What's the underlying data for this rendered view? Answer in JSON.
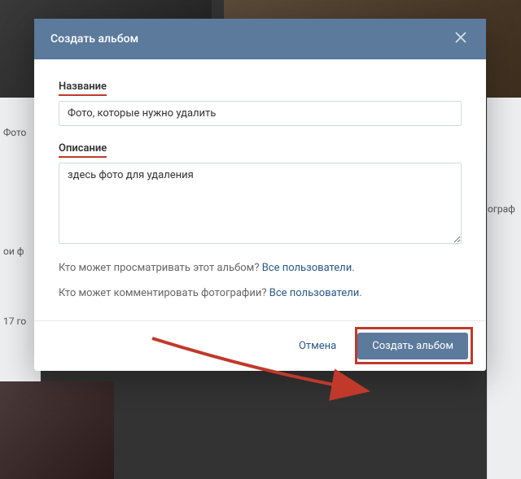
{
  "background": {
    "sidebar_label_1": "Фото",
    "sidebar_label_2": "ои ф",
    "sidebar_label_3": "17 го",
    "right_label": "ограф"
  },
  "modal": {
    "title": "Создать альбом",
    "fields": {
      "name_label": "Название",
      "name_value": "Фото, которые нужно удалить",
      "desc_label": "Описание",
      "desc_value": "здесь фото для удаления"
    },
    "privacy": {
      "view_question": "Кто может просматривать этот альбом? ",
      "view_value": "Все пользователи",
      "comment_question": "Кто может комментировать фотографии? ",
      "comment_value": "Все пользователи",
      "suffix": "."
    },
    "buttons": {
      "cancel": "Отмена",
      "submit": "Создать альбом"
    }
  }
}
